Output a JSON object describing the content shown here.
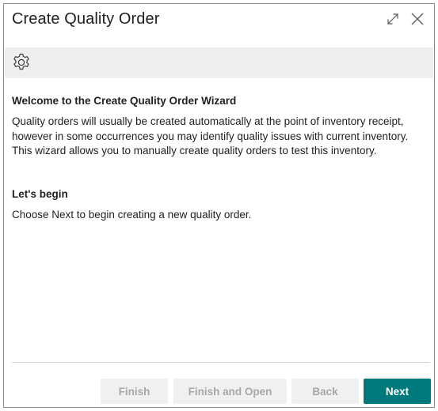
{
  "dialog": {
    "title": "Create Quality Order",
    "expand_icon": "expand-icon",
    "close_icon": "close-icon"
  },
  "step_bar": {
    "icon": "gear-icon"
  },
  "welcome": {
    "heading": "Welcome to the Create Quality Order Wizard",
    "body": "Quality orders will usually be created automatically at the point of inventory receipt, however in some occurrences you may identify quality issues with current inventory. This wizard allows you to manually create quality orders to test this inventory."
  },
  "begin": {
    "heading": "Let's begin",
    "body": "Choose Next to begin creating a new quality order."
  },
  "footer": {
    "finish_label": "Finish",
    "finish_open_label": "Finish and Open",
    "back_label": "Back",
    "next_label": "Next"
  },
  "colors": {
    "accent": "#00797c",
    "step_bar_bg": "#efefef",
    "disabled_bg": "#f0f0f0",
    "disabled_text": "#a8a8a8"
  }
}
